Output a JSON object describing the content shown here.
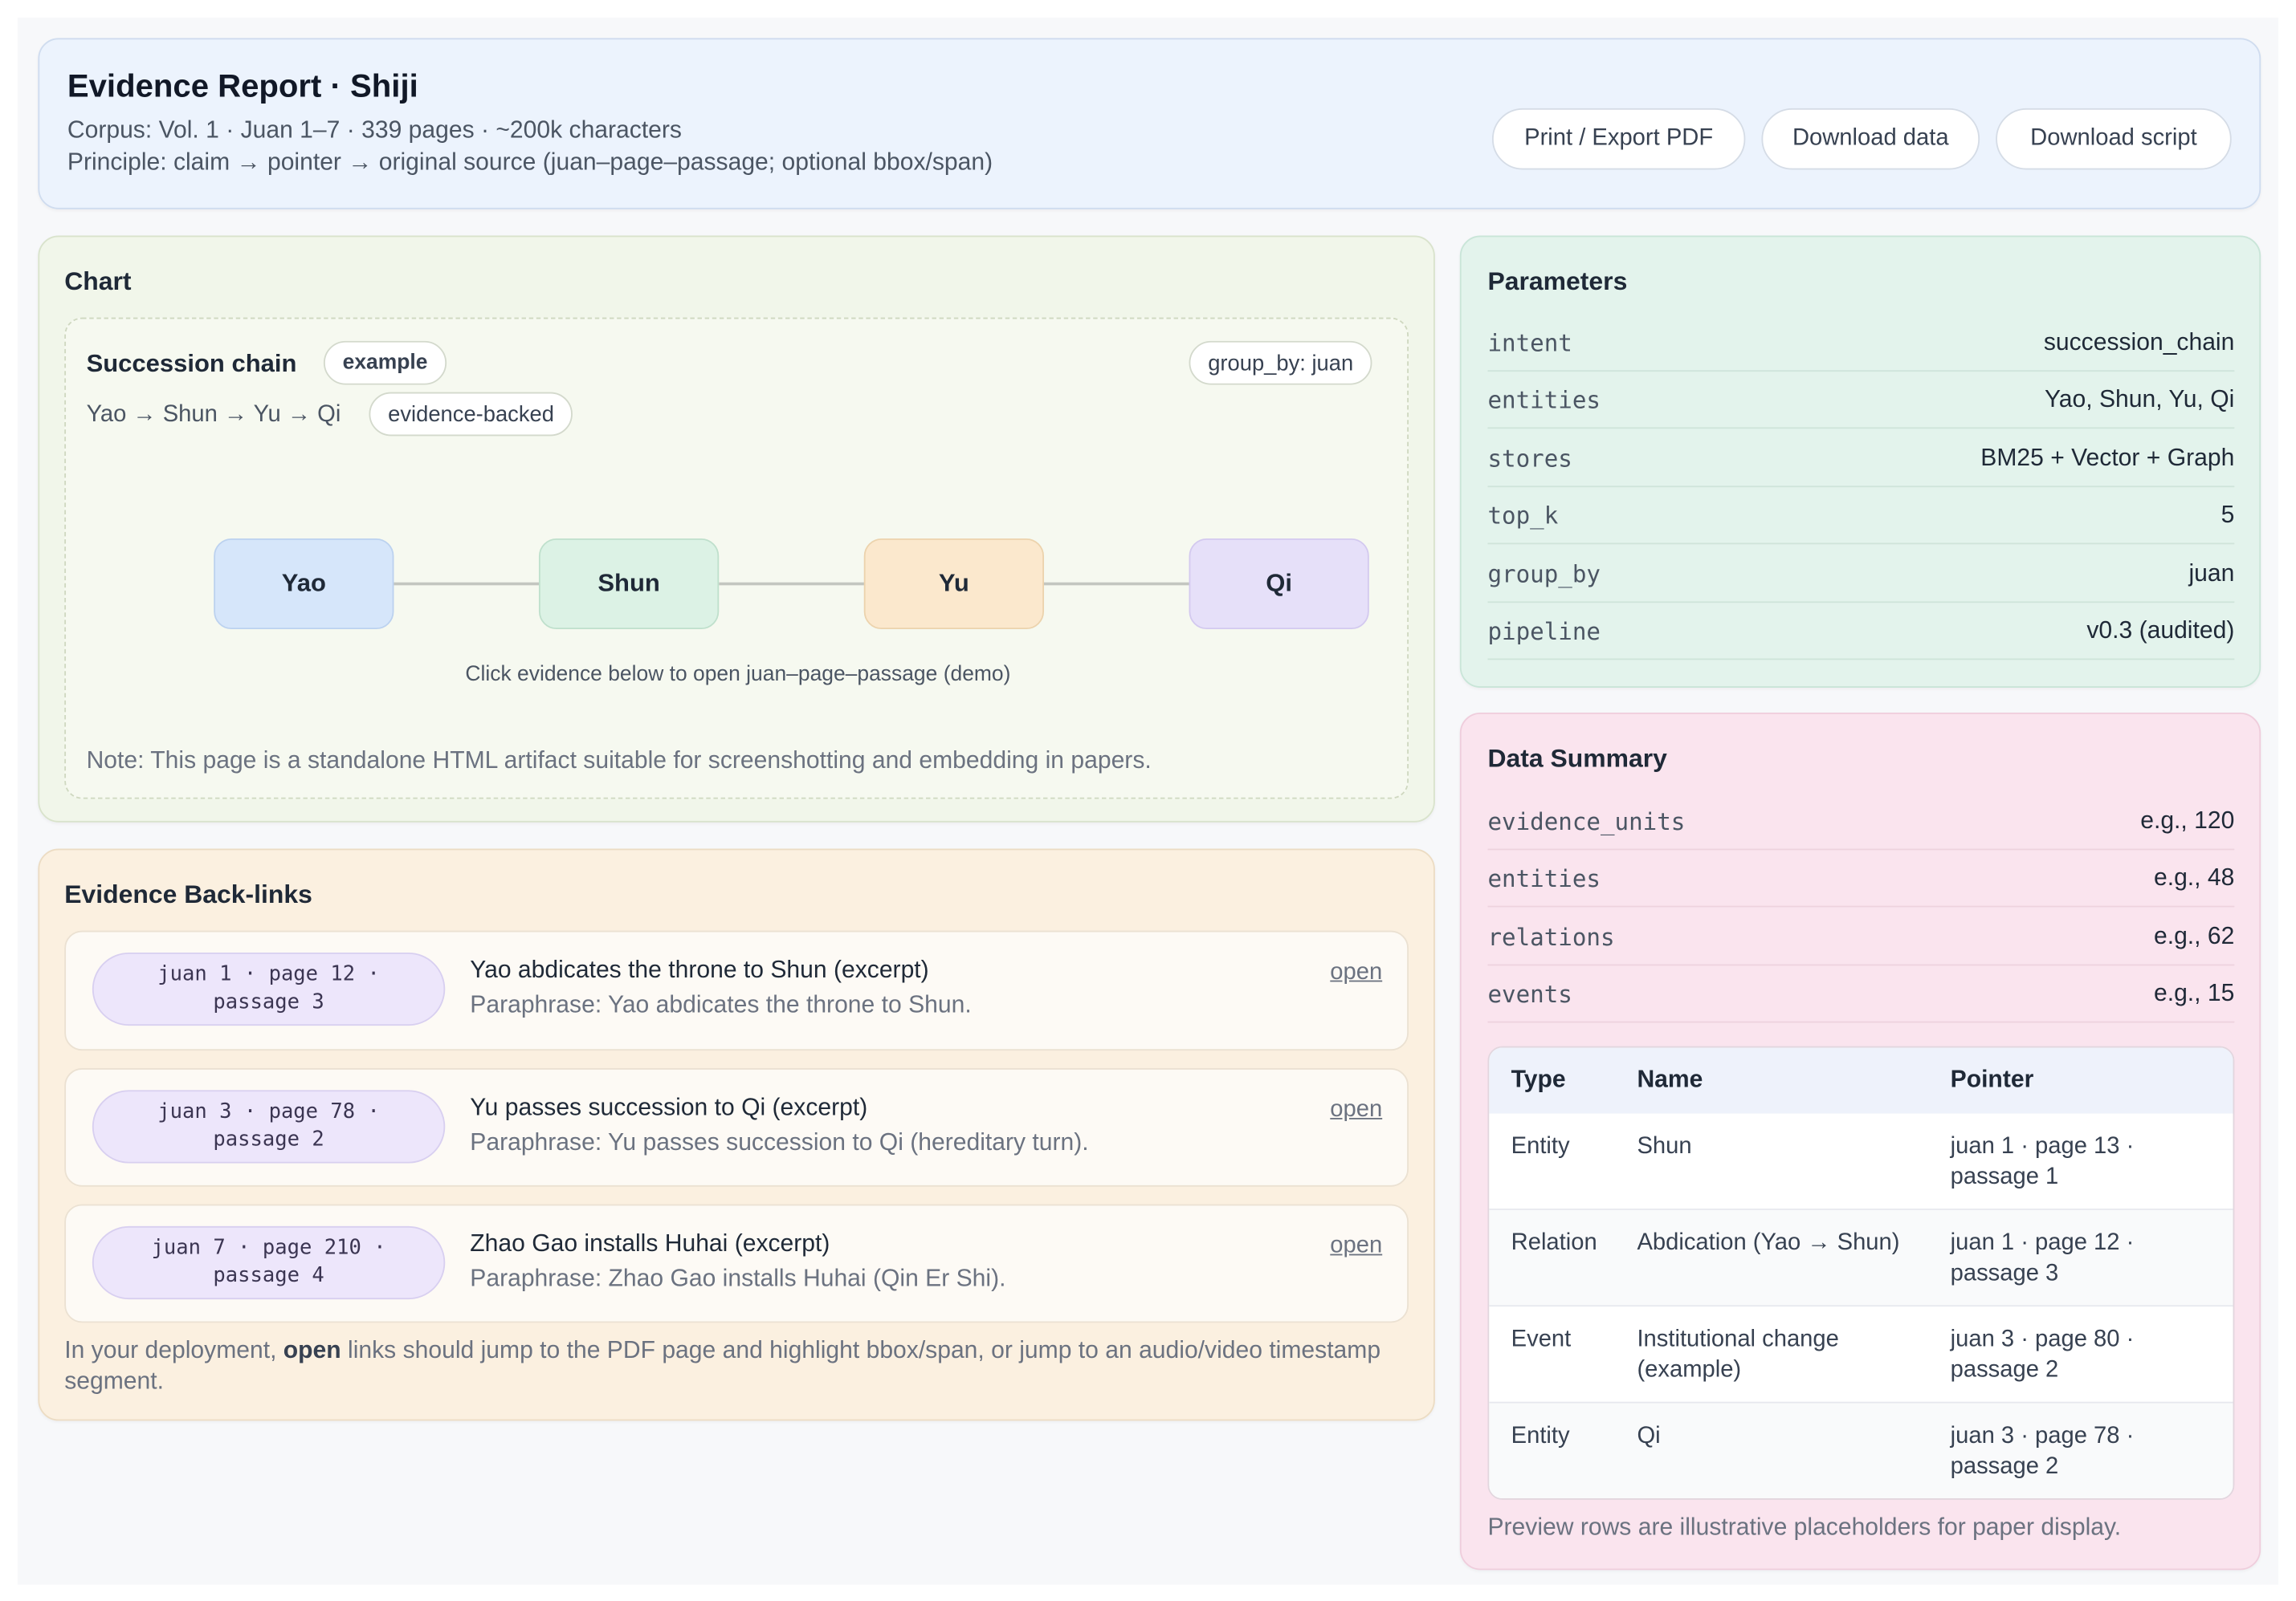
{
  "header": {
    "title": "Evidence Report · Shiji",
    "corpus_line": "Corpus: Vol. 1 · Juan 1–7 · 339 pages · ~200k characters",
    "principle_line": "Principle: claim → pointer → original source (juan–page–passage; optional bbox/span)",
    "buttons": {
      "print": "Print / Export PDF",
      "download_data": "Download data",
      "download_script": "Download script"
    }
  },
  "chart": {
    "section_title": "Chart",
    "panel_title": "Succession chain",
    "badge_example": "example",
    "group_by_chip": "group_by: juan",
    "chain_text": "Yao → Shun → Yu → Qi",
    "badge_evidence": "evidence-backed",
    "nodes": [
      "Yao",
      "Shun",
      "Yu",
      "Qi"
    ],
    "node_colors": [
      "#d6e6fa",
      "#dcf2e5",
      "#fbe8cd",
      "#e6e0f9"
    ],
    "hint": "Click evidence below to open juan–page–passage (demo)",
    "note": "Note: This page is a standalone HTML artifact suitable for screenshotting and embedding in papers."
  },
  "evidence": {
    "section_title": "Evidence Back-links",
    "items": [
      {
        "pointer": "juan 1 · page 12 · passage 3",
        "title": "Yao abdicates the throne to Shun (excerpt)",
        "paraphrase": "Paraphrase: Yao abdicates the throne to Shun.",
        "link": "open"
      },
      {
        "pointer": "juan 3 · page 78 · passage 2",
        "title": "Yu passes succession to Qi (excerpt)",
        "paraphrase": "Paraphrase: Yu passes succession to Qi (hereditary turn).",
        "link": "open"
      },
      {
        "pointer": "juan 7 · page 210 · passage 4",
        "title": "Zhao Gao installs Huhai (excerpt)",
        "paraphrase": "Paraphrase: Zhao Gao installs Huhai (Qin Er Shi).",
        "link": "open"
      }
    ],
    "footer_pre": "In your deployment, ",
    "footer_bold": "open",
    "footer_post": " links should jump to the PDF page and highlight bbox/span, or jump to an audio/video timestamp segment."
  },
  "parameters": {
    "section_title": "Parameters",
    "rows": [
      {
        "key": "intent",
        "value": "succession_chain"
      },
      {
        "key": "entities",
        "value": "Yao, Shun, Yu, Qi"
      },
      {
        "key": "stores",
        "value": "BM25 + Vector + Graph"
      },
      {
        "key": "top_k",
        "value": "5"
      },
      {
        "key": "group_by",
        "value": "juan"
      },
      {
        "key": "pipeline",
        "value": "v0.3 (audited)"
      }
    ]
  },
  "summary": {
    "section_title": "Data Summary",
    "rows": [
      {
        "key": "evidence_units",
        "value": "e.g., 120"
      },
      {
        "key": "entities",
        "value": "e.g., 48"
      },
      {
        "key": "relations",
        "value": "e.g., 62"
      },
      {
        "key": "events",
        "value": "e.g., 15"
      }
    ],
    "table": {
      "headers": [
        "Type",
        "Name",
        "Pointer"
      ],
      "rows": [
        {
          "type": "Entity",
          "name": "Shun",
          "pointer": "juan 1 · page 13 · passage 1"
        },
        {
          "type": "Relation",
          "name": "Abdication (Yao → Shun)",
          "pointer": "juan 1 · page 12 · passage 3"
        },
        {
          "type": "Event",
          "name": "Institutional change (example)",
          "pointer": "juan 3 · page 80 · passage 2"
        },
        {
          "type": "Entity",
          "name": "Qi",
          "pointer": "juan 3 · page 78 · passage 2"
        }
      ]
    },
    "footnote": "Preview rows are illustrative placeholders for paper display."
  }
}
